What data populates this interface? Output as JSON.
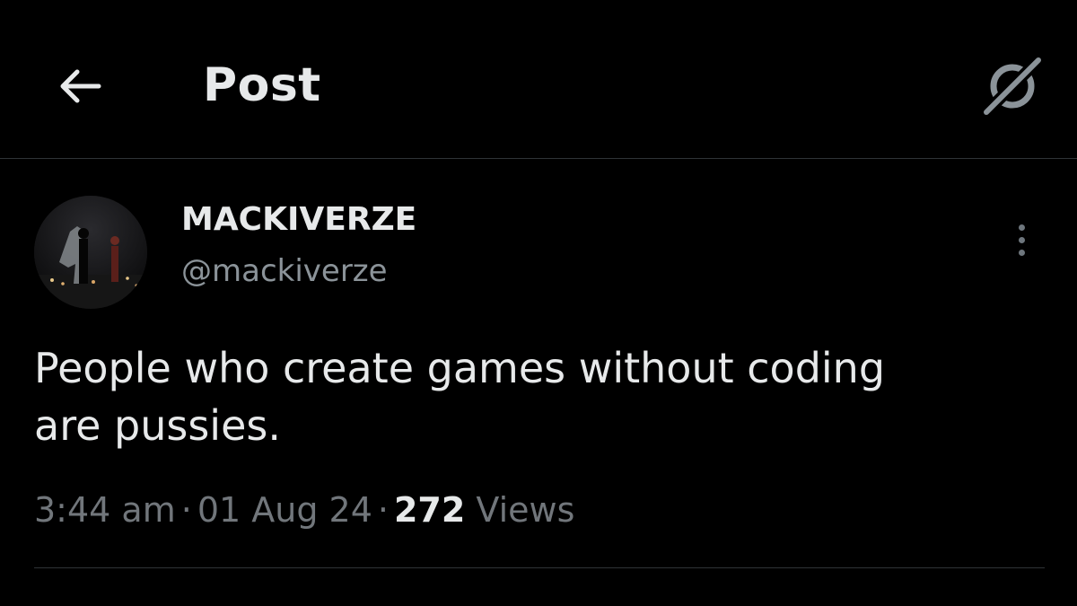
{
  "header": {
    "title": "Post",
    "back_icon": "arrow-left-icon",
    "grok_icon": "grok-icon"
  },
  "post": {
    "author": {
      "display_name": "MACKIVERZE",
      "handle": "@mackiverze"
    },
    "text": "People who create games without coding\nare pussies.",
    "meta": {
      "time": "3:44 am",
      "separator": "·",
      "date": "01 Aug 24",
      "views_count": "272",
      "views_label": "Views"
    },
    "more_icon": "more-vertical-icon"
  },
  "colors": {
    "background": "#000000",
    "primary_text": "#e7e9ea",
    "secondary_text": "#71767b",
    "divider": "#2f3336"
  }
}
